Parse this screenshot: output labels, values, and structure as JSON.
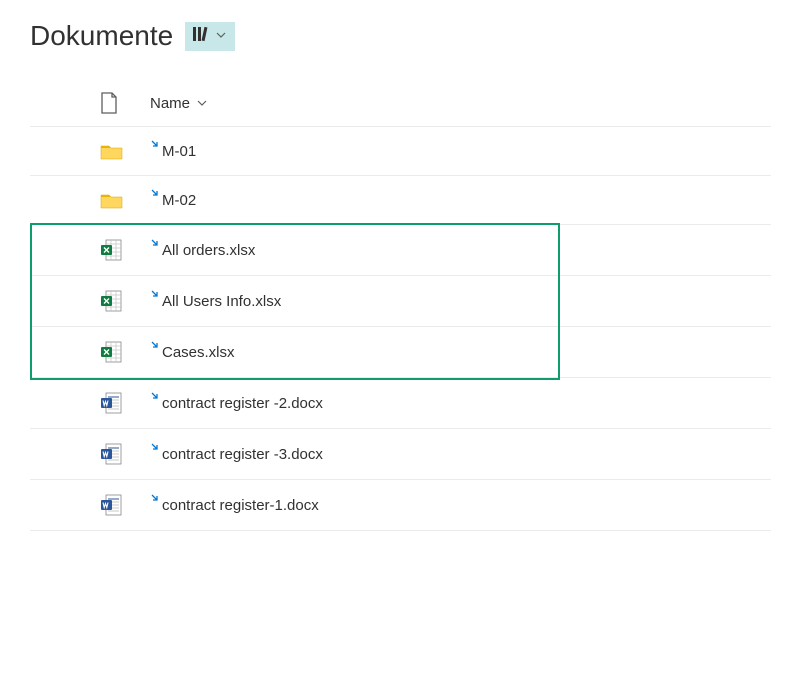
{
  "header": {
    "title": "Dokumente"
  },
  "columns": {
    "name": "Name"
  },
  "rows": [
    {
      "type": "folder",
      "name": "M-01",
      "isLink": true
    },
    {
      "type": "folder",
      "name": "M-02",
      "isLink": true
    },
    {
      "type": "excel",
      "name": "All orders.xlsx",
      "isLink": true
    },
    {
      "type": "excel",
      "name": "All Users Info.xlsx",
      "isLink": true
    },
    {
      "type": "excel",
      "name": "Cases.xlsx",
      "isLink": true
    },
    {
      "type": "word",
      "name": "contract register -2.docx",
      "isLink": true
    },
    {
      "type": "word",
      "name": "contract register -3.docx",
      "isLink": true
    },
    {
      "type": "word",
      "name": "contract register-1.docx",
      "isLink": true
    }
  ],
  "highlight": {
    "startRow": 2,
    "endRow": 4
  }
}
